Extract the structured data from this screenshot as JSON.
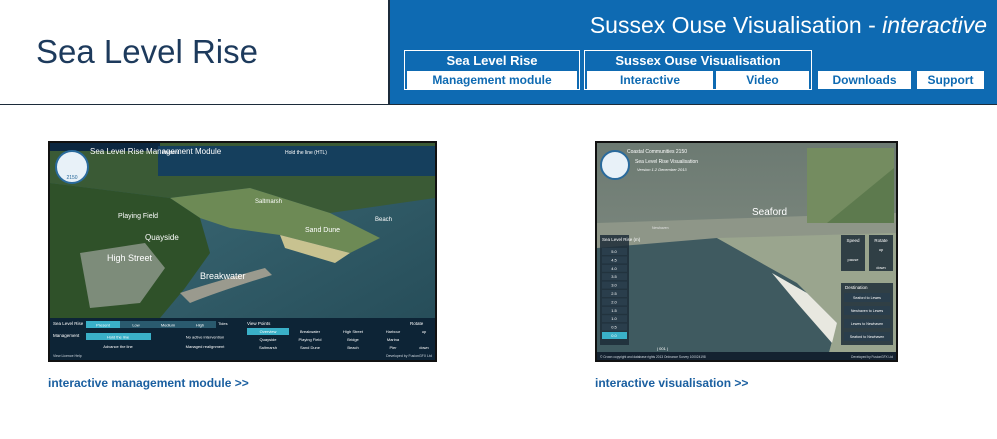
{
  "header": {
    "site_title": "Sea Level Rise",
    "banner_main": "Sussex Ouse Visualisation - ",
    "banner_italic": "interactive"
  },
  "nav": {
    "slr": {
      "title": "Sea Level Rise",
      "management": "Management module"
    },
    "sov": {
      "title": "Sussex Ouse Visualisation",
      "interactive": "Interactive",
      "video": "Video"
    },
    "downloads": "Downloads",
    "support": "Support"
  },
  "thumb1": {
    "link": "interactive management module >>",
    "title": "Sea Level Rise Management Module",
    "logo_year": "2150",
    "present": "Present",
    "hold": "Hold the line (HTL)",
    "places": {
      "playing_field": "Playing Field",
      "quayside": "Quayside",
      "high_street": "High Street",
      "saltmarsh": "Saltmarsh",
      "sand_dune": "Sand Dune",
      "beach": "Beach",
      "breakwater": "Breakwater"
    },
    "panel": {
      "slr_label": "Sea Level Rise",
      "mgmt_label": "Management",
      "levels": [
        "Present",
        "Low",
        "Medium",
        "High"
      ],
      "tides": "Tides",
      "hold_the_line": "Hold the line",
      "no_active": "No active intervention",
      "advance": "Advance the line",
      "managed": "Managed realignment",
      "view_points": "View Points",
      "rotate": "Rotate",
      "views": [
        "Overview",
        "Breakwater",
        "High Street",
        "Harbour",
        "Quayside",
        "Playing Field",
        "Bridge",
        "Marina",
        "Saltmarsh",
        "Sand Dune",
        "Beach",
        "Pier"
      ],
      "up": "up",
      "down": "down",
      "footer_left": "View Licence   Help",
      "footer_right": "Developed by FusionGFX Ltd"
    }
  },
  "thumb2": {
    "link": "interactive visualisation >>",
    "coastal": "Coastal Communities 2150",
    "subtitle": "Sea Level Rise Visualisation",
    "version": "Version 1.2  December 2013",
    "seaford": "Seaford",
    "newhaven": "Newhaven",
    "slr_title": "Sea Level Rise (m)",
    "levels": [
      "5.0",
      "4.5",
      "4.0",
      "3.5",
      "3.0",
      "2.5",
      "2.0",
      "1.5",
      "1.0",
      "0.5",
      "0.0"
    ],
    "speed": "Speed",
    "rotate": "Rotate",
    "pause": "pause",
    "up": "up",
    "down": "down",
    "destination": "Destination",
    "dests": [
      "Seaford to Lewes",
      "Newhaven to Lewes",
      "Lewes to Newhaven",
      "Seaford to Newhaven"
    ],
    "footer_left": "© Crown copyright and database rights 2013 Ordnance Survey 100024198",
    "footer_right": "Developed by FusionGFX Ltd",
    "counter": "| 001 |"
  }
}
